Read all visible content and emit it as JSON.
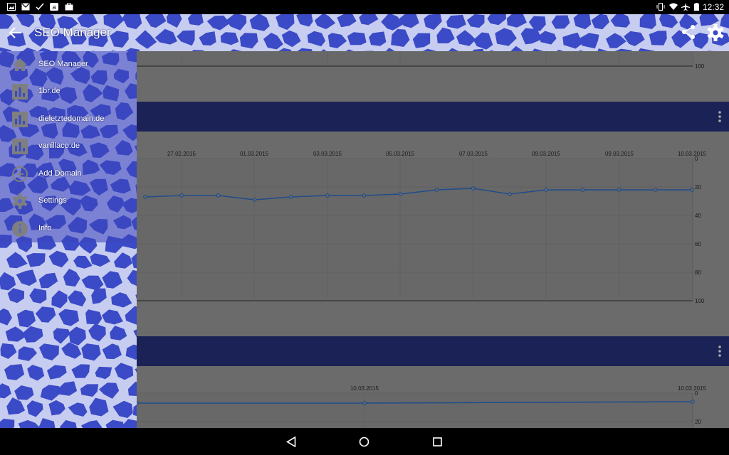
{
  "status_bar": {
    "time": "12:32",
    "left_icons": [
      "image-icon",
      "gmail-icon",
      "check-icon",
      "amazon-icon",
      "bag-icon"
    ],
    "right_icons": [
      "vibrate-icon",
      "wifi-icon",
      "airplane-icon",
      "battery-icon"
    ]
  },
  "action_bar": {
    "title": "SEO Manager",
    "actions": [
      "share-icon",
      "settings-icon"
    ],
    "colors": {
      "pattern_light": "#c7cdf0",
      "pattern_dark": "#3b4ac6"
    }
  },
  "drawer": {
    "items": [
      {
        "label": "SEO Manager",
        "icon": "home-icon"
      },
      {
        "label": "1br.de",
        "icon": "bar-chart-icon"
      },
      {
        "label": "dieletztedomain.de",
        "icon": "bar-chart-icon"
      },
      {
        "label": "vanillaco.de",
        "icon": "bar-chart-icon"
      },
      {
        "label": "Add Domain",
        "icon": "add-circle-icon"
      },
      {
        "label": "Settings",
        "icon": "gear-icon"
      },
      {
        "label": "Info",
        "icon": "info-icon"
      }
    ]
  },
  "chart_data": [
    {
      "type": "line",
      "x_labels": [],
      "y_ticks": [
        100
      ],
      "points": [],
      "ylim": [
        0,
        100
      ],
      "grid": true,
      "partial": true
    },
    {
      "type": "line",
      "x_labels": [
        "27.02.2015",
        "01.03.2015",
        "03.03.2015",
        "05.03.2015",
        "07.03.2015",
        "09.03.2015",
        "09.03.2015",
        "10.03.2015"
      ],
      "y_ticks": [
        0,
        20,
        40,
        60,
        80,
        100
      ],
      "values": [
        27,
        26,
        26,
        29,
        27,
        26,
        26,
        25,
        22,
        21,
        25,
        22,
        22,
        22,
        22,
        22
      ],
      "ylim": [
        0,
        100
      ],
      "y_inverted": true,
      "grid": true,
      "line_color": "#1f4c8c"
    },
    {
      "type": "line",
      "x_labels": [
        "10.03.2015",
        "10.03.2015"
      ],
      "y_ticks": [
        0,
        20
      ],
      "values": [
        7,
        7,
        6
      ],
      "ylim": [
        0,
        100
      ],
      "y_inverted": true,
      "grid": true,
      "partial": true,
      "line_color": "#1f4c8c"
    }
  ],
  "nav_bar": {
    "buttons": [
      "back-icon",
      "home-icon",
      "recents-icon"
    ]
  }
}
